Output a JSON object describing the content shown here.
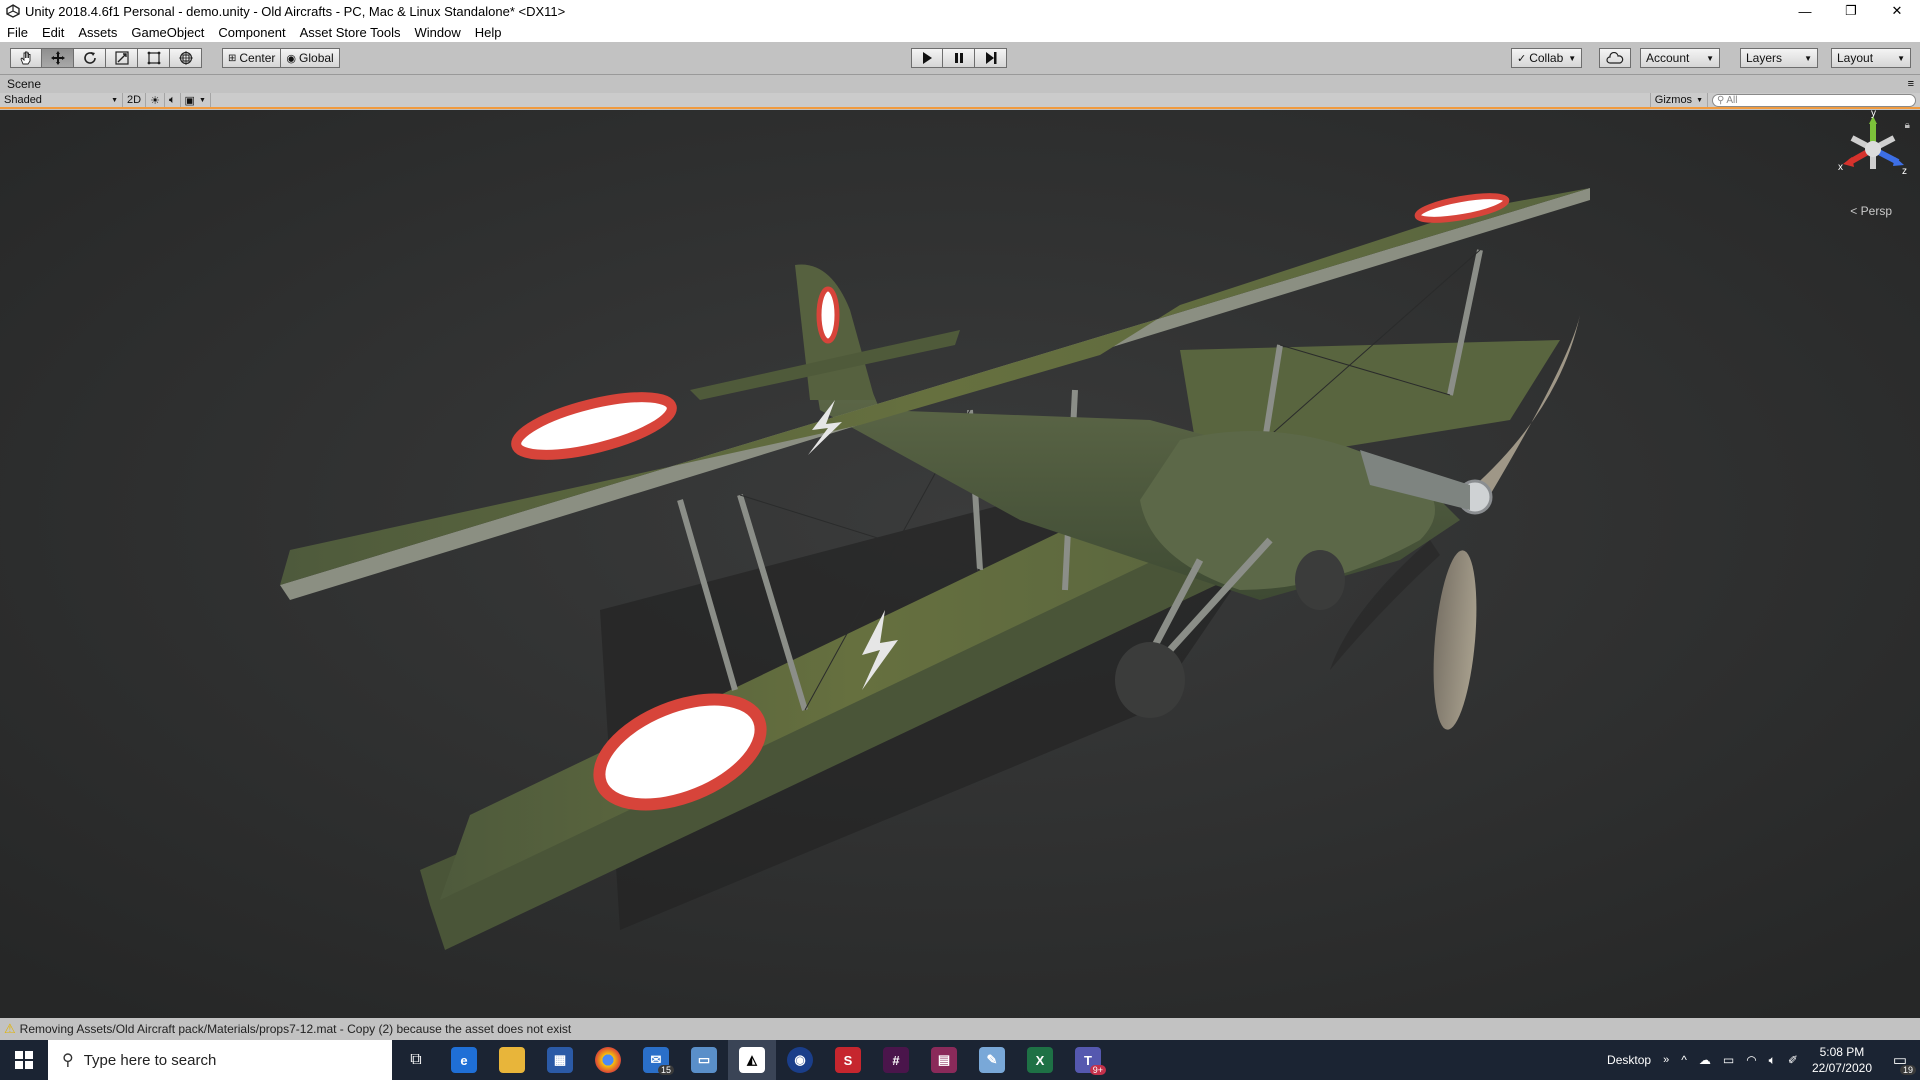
{
  "window": {
    "title": "Unity 2018.4.6f1 Personal - demo.unity - Old Aircrafts - PC, Mac & Linux Standalone* <DX11>",
    "minimize": "—",
    "maximize": "❐",
    "close": "✕"
  },
  "menu": [
    "File",
    "Edit",
    "Assets",
    "GameObject",
    "Component",
    "Asset Store Tools",
    "Window",
    "Help"
  ],
  "toolbar": {
    "tools": [
      "hand-tool",
      "move-tool",
      "rotate-tool",
      "scale-tool",
      "rect-tool",
      "transform-tool"
    ],
    "pivot_mode": "Center",
    "pivot_rotation": "Global",
    "collab": "Collab",
    "account": "Account",
    "layers": "Layers",
    "layout": "Layout"
  },
  "scene": {
    "tab": "Scene",
    "draw_mode": "Shaded",
    "mode_2d": "2D",
    "gizmos": "Gizmos",
    "search_placeholder": "All",
    "projection": "< Persp",
    "axis_x": "x",
    "axis_y": "y",
    "axis_z": "z"
  },
  "status": {
    "message": "Removing Assets/Old Aircraft pack/Materials/props7-12.mat - Copy (2) because the asset does not exist"
  },
  "taskbar": {
    "search_placeholder": "Type here to search",
    "mail_badge": "15",
    "teams_badge": "9+",
    "desktop_label": "Desktop",
    "time": "5:08 PM",
    "date": "22/07/2020",
    "notifications": "19"
  },
  "colors": {
    "accent_orange": "#f09a3e",
    "viewport_bg": "#2f3030",
    "taskbar_bg": "#1b2433"
  }
}
